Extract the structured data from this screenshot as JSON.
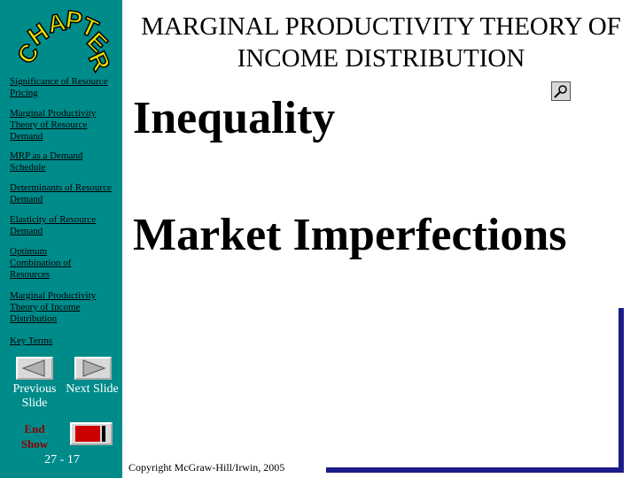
{
  "title": "MARGINAL PRODUCTIVITY THEORY OF INCOME DISTRIBUTION",
  "logo_text": "CHAPTER",
  "nav_links": [
    {
      "label": "Significance of Resource Pricing"
    },
    {
      "label": "Marginal Productivity Theory of Resource Demand"
    },
    {
      "label": "MRP as a Demand Schedule"
    },
    {
      "label": "Determinants of Resource Demand"
    },
    {
      "label": "Elasticity of Resource Demand"
    },
    {
      "label": "Optimum Combination of Resources"
    },
    {
      "label": "Marginal Productivity Theory of Income Distribution"
    },
    {
      "label": "Key Terms"
    }
  ],
  "buttons": {
    "previous": "Previous Slide",
    "next": "Next Slide",
    "end": "End Show"
  },
  "page_number": "27 - 17",
  "main": {
    "heading1": "Inequality",
    "heading2": "Market Imperfections"
  },
  "copyright": "Copyright McGraw-Hill/Irwin, 2005",
  "colors": {
    "sidebar": "#008b8b",
    "logo": "#e8e000",
    "accent_line": "#1c1c8a",
    "end_label": "#8b0000"
  }
}
